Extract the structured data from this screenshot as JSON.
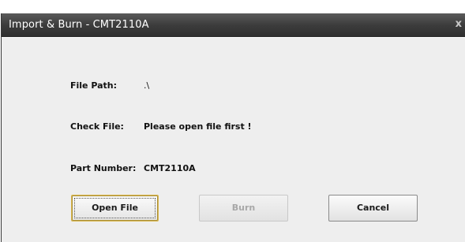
{
  "window": {
    "title": "Import & Burn - CMT2110A",
    "close_glyph": "x",
    "icons": {
      "close": "close-icon"
    }
  },
  "fields": {
    "file_path_label": "File Path:",
    "file_path_value": ".\\",
    "check_file_label": "Check File:",
    "check_file_value": "Please open file first !",
    "part_number_label": "Part Number:",
    "part_number_value": "CMT2110A"
  },
  "buttons": {
    "open_file": "Open File",
    "burn": "Burn",
    "burn_enabled": false,
    "cancel": "Cancel"
  },
  "colors": {
    "titlebar": "#3c3c3c",
    "dialog_background": "#eeeeee",
    "focused_button_border": "#d9b64c",
    "disabled_text": "#a8a8a8"
  }
}
